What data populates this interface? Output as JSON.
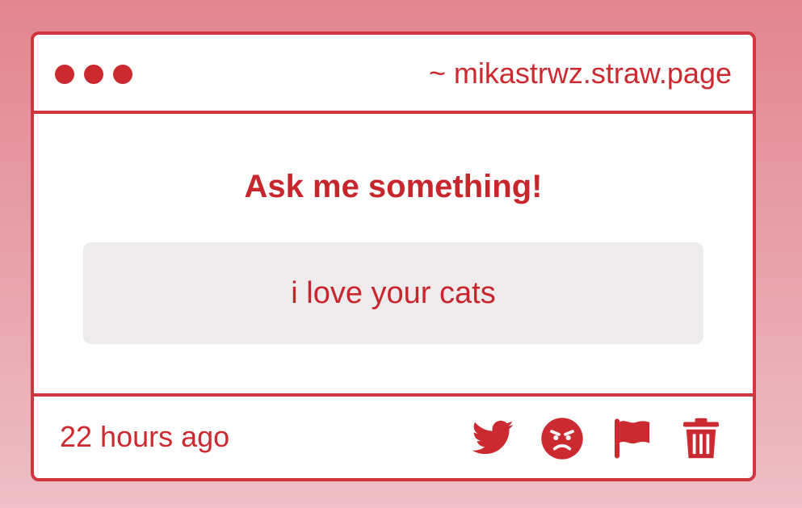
{
  "window": {
    "url": "~ mikastrwz.straw.page"
  },
  "question": {
    "prompt": "Ask me something!",
    "answer": "i love your cats"
  },
  "footer": {
    "timestamp": "22 hours ago",
    "actions": [
      {
        "icon": "twitter-icon"
      },
      {
        "icon": "angry-face-icon"
      },
      {
        "icon": "flag-icon"
      },
      {
        "icon": "trash-icon"
      }
    ]
  },
  "colors": {
    "accent": "#cc2a31",
    "border": "#d0363d",
    "answer_bg": "#edebeb",
    "background_top": "#e2858f",
    "background_bottom": "#eebfc6"
  }
}
